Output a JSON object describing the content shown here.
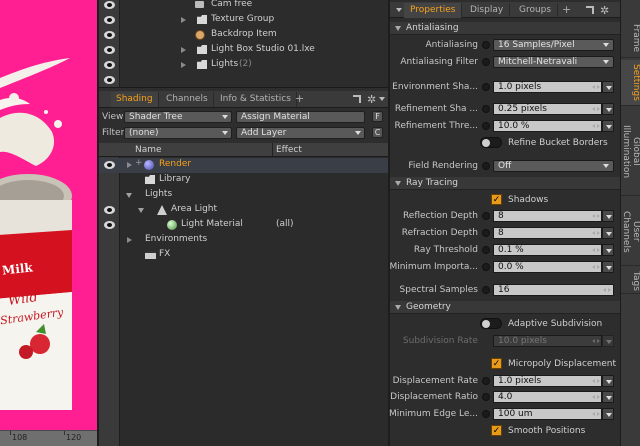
{
  "viewport": {
    "label_text": "Milk",
    "label_sub1": "Wild",
    "label_sub2": "Strawberry",
    "ruler": [
      "108",
      "120"
    ],
    "bg_color": "#ff1f93"
  },
  "items": [
    {
      "label": "Cam free",
      "icon": "camera-icon"
    },
    {
      "label": "Texture Group",
      "icon": "folder-icon"
    },
    {
      "label": "Backdrop Item",
      "icon": "mesh-icon"
    },
    {
      "label": "Light Box Studio 01.lxe",
      "icon": "folder-icon"
    },
    {
      "label": "Lights",
      "sub": "(2)",
      "icon": "folder-icon"
    }
  ],
  "shading": {
    "tabs": [
      "Shading",
      "Channels",
      "Info & Statistics"
    ],
    "view_label": "View",
    "view_value": "Shader Tree",
    "assign_material": "Assign Material",
    "filter_label": "Filter",
    "filter_value": "(none)",
    "add_layer": "Add Layer",
    "f_button": "F",
    "c_button": "C",
    "col_name": "Name",
    "col_effect": "Effect",
    "tree": [
      {
        "label": "Render",
        "effect": ""
      },
      {
        "label": "Library",
        "effect": ""
      },
      {
        "label": "Lights",
        "effect": ""
      },
      {
        "label": "Area Light",
        "effect": ""
      },
      {
        "label": "Light Material",
        "effect": "(all)"
      },
      {
        "label": "Environments",
        "effect": ""
      },
      {
        "label": "FX",
        "effect": ""
      }
    ]
  },
  "properties": {
    "tabs": [
      "Properties",
      "Display",
      "Groups"
    ],
    "sections": {
      "antialiasing": "Antialiasing",
      "raytracing": "Ray Tracing",
      "geometry": "Geometry"
    },
    "rows": {
      "antialiasing": {
        "label": "Antialiasing",
        "value": "16 Samples/Pixel"
      },
      "aa_filter": {
        "label": "Antialiasing Filter",
        "value": "Mitchell-Netravali"
      },
      "env_shading": {
        "label": "Environment Sha...",
        "value": "1.0 pixels"
      },
      "ref_shading": {
        "label": "Refinement Sha ...",
        "value": "0.25 pixels"
      },
      "ref_threshold": {
        "label": "Refinement Thre...",
        "value": "10.0 %"
      },
      "refine_bucket": {
        "label": "Refine Bucket Borders"
      },
      "field_rendering": {
        "label": "Field Rendering",
        "value": "Off"
      },
      "shadows": {
        "label": "Shadows"
      },
      "refl_depth": {
        "label": "Reflection Depth",
        "value": "8"
      },
      "refr_depth": {
        "label": "Refraction Depth",
        "value": "8"
      },
      "ray_threshold": {
        "label": "Ray Threshold",
        "value": "0.1 %"
      },
      "min_importance": {
        "label": "Minimum Importa...",
        "value": "0.0 %"
      },
      "spectral": {
        "label": "Spectral Samples",
        "value": "16"
      },
      "adaptive": {
        "label": "Adaptive Subdivision"
      },
      "subdiv_rate": {
        "label": "Subdivision Rate",
        "value": "10.0 pixels"
      },
      "micropoly": {
        "label": "Micropoly Displacement"
      },
      "disp_rate": {
        "label": "Displacement Rate",
        "value": "1.0 pixels"
      },
      "disp_ratio": {
        "label": "Displacement Ratio",
        "value": "4.0"
      },
      "min_edge": {
        "label": "Minimum Edge Le...",
        "value": "100 um"
      },
      "smooth_pos": {
        "label": "Smooth Positions"
      }
    }
  },
  "side_tabs": [
    "Frame",
    "Settings",
    "Global Illumination",
    "User Channels",
    "Tags"
  ],
  "accent_color": "#f6a11b"
}
